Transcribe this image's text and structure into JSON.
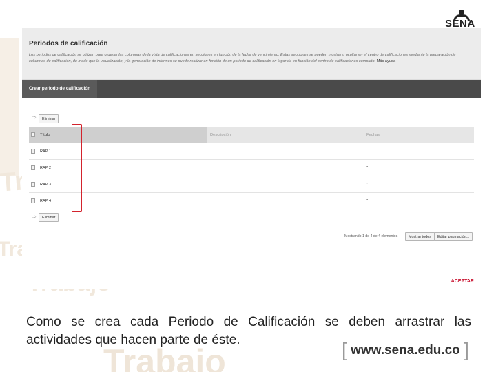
{
  "brand": {
    "logo_text": "SENA",
    "url": "www.sena.edu.co"
  },
  "watermark_words": [
    "Trabajo",
    "Trabajo",
    "Trabajo",
    "Trabajo"
  ],
  "panel": {
    "title": "Periodos de calificación",
    "description": "Los periodos de calificación se utilizan para ordenar las columnas de la vista de calificaciones en secciones en función de la fecha de vencimiento. Estas secciones se pueden mostrar u ocultar en el centro de calificaciones mediante la preparación de columnas de calificación, de modo que la visualización, y la generación de informes se puede realizar en función de un periodo de calificación en lugar de en función del centro de calificaciones completo.",
    "more_link": "Más ayuda",
    "toolbar_button": "Crear periodo de calificación",
    "delete_button_top": "Eliminar",
    "delete_button_bottom": "Eliminar",
    "columns": {
      "title": "Título",
      "description": "Descripción",
      "dates": "Fechas"
    },
    "rows": [
      {
        "name": "RAP 1",
        "date": ""
      },
      {
        "name": "RAP 2",
        "date": "-"
      },
      {
        "name": "RAP 3",
        "date": "-"
      },
      {
        "name": "RAP 4",
        "date": "-"
      }
    ],
    "paging_text": "Mostrando 1 de 4 de 4 elementos",
    "show_all_button": "Mostrar todos",
    "edit_paging_button": "Editar paginación...",
    "accept_button": "ACEPTAR"
  },
  "caption": "Como se crea cada Periodo de Calificación se deben arrastrar las actividades que hacen parte de éste.",
  "colors": {
    "highlight_bracket": "#d3232d",
    "accept": "#c8102e",
    "toolbar": "#4a4a4a"
  }
}
